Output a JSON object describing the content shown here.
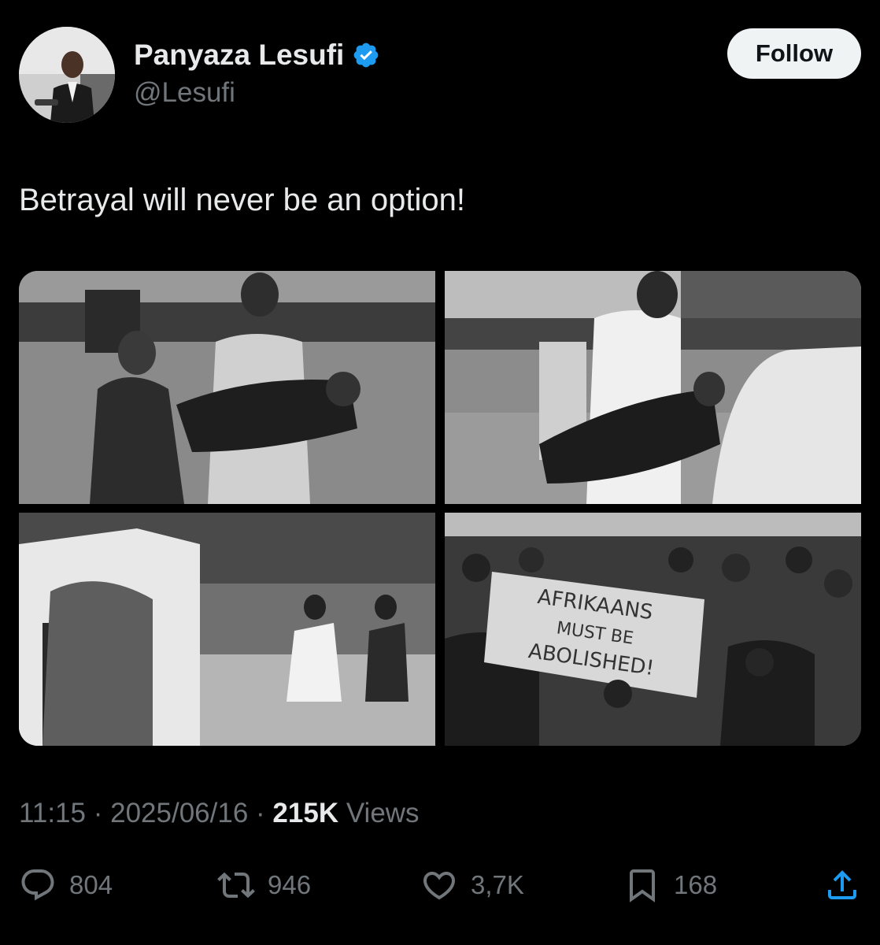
{
  "author": {
    "display_name": "Panyaza Lesufi",
    "handle": "@Lesufi",
    "verified_icon": "verified-badge-icon",
    "avatar_icon": "avatar"
  },
  "follow_button": {
    "label": "Follow"
  },
  "tweet": {
    "text": "Betrayal will never be an option!"
  },
  "media": {
    "photos": [
      {
        "name": "photo-1"
      },
      {
        "name": "photo-2"
      },
      {
        "name": "photo-3"
      },
      {
        "name": "photo-4"
      }
    ],
    "banner_text": "AFRIKAANS MUST BE ABOLISHED"
  },
  "meta": {
    "time": "11:15",
    "separator": "·",
    "date": "2025/06/16",
    "views_count": "215K",
    "views_label": "Views"
  },
  "actions": {
    "reply": {
      "icon": "reply-icon",
      "count": "804"
    },
    "retweet": {
      "icon": "retweet-icon",
      "count": "946"
    },
    "like": {
      "icon": "heart-icon",
      "count": "3,7K"
    },
    "bookmark": {
      "icon": "bookmark-icon",
      "count": "168"
    },
    "share": {
      "icon": "share-icon"
    }
  },
  "colors": {
    "background": "#000000",
    "text_primary": "#e7e9ea",
    "text_secondary": "#71767b",
    "verified": "#1d9bf0",
    "follow_bg": "#eff3f4"
  }
}
